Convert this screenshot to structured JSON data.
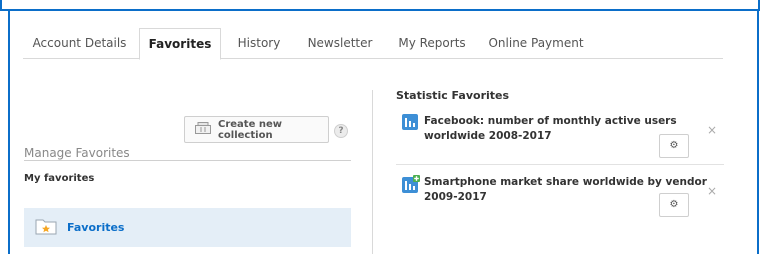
{
  "tabs": [
    {
      "label": "Account Details"
    },
    {
      "label": "Favorites"
    },
    {
      "label": "History"
    },
    {
      "label": "Newsletter"
    },
    {
      "label": "My Reports"
    },
    {
      "label": "Online Payment"
    }
  ],
  "active_tab": "Favorites",
  "left_panel": {
    "create_button_label": "Create new collection",
    "help_label": "?",
    "manage_title": "Manage Favorites",
    "my_favorites_label": "My favorites",
    "collections": [
      {
        "label": "Favorites",
        "icon": "folder-star-icon"
      }
    ]
  },
  "right_panel": {
    "title": "Statistic Favorites",
    "items": [
      {
        "title": "Facebook: number of monthly active users worldwide 2008-2017",
        "icon": "bar-chart-icon"
      },
      {
        "title": "Smartphone market share worldwide by vendor 2009-2017",
        "icon": "bar-chart-plus-icon"
      }
    ],
    "close_glyph": "×"
  },
  "colors": {
    "accent": "#0b6ec9",
    "selected_bg": "#e4eef7",
    "icon_green": "#4caf50"
  }
}
